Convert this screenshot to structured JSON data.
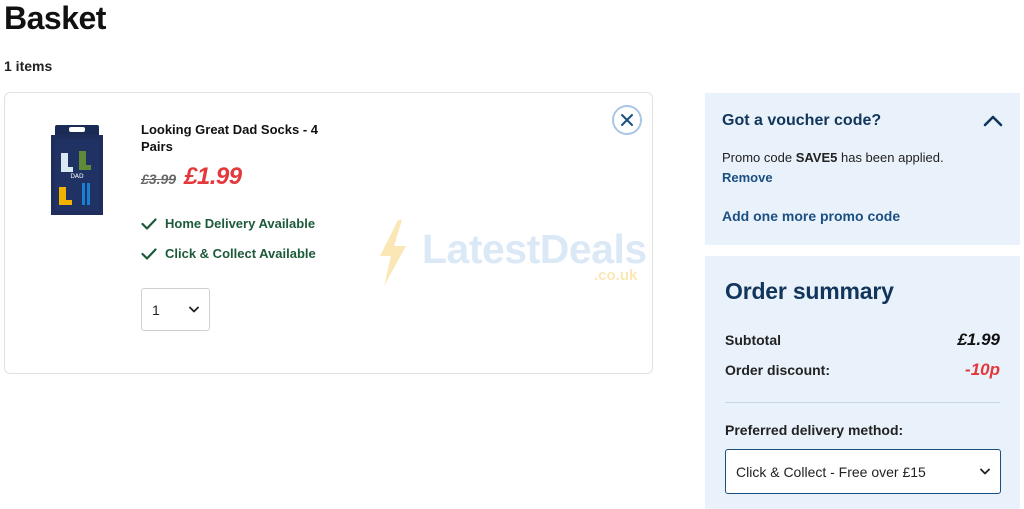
{
  "page": {
    "title": "Basket",
    "item_count": "1 items"
  },
  "basket_item": {
    "name": "Looking Great Dad Socks - 4 Pairs",
    "old_price": "£3.99",
    "price": "£1.99",
    "availability": [
      "Home Delivery Available",
      "Click & Collect Available"
    ],
    "quantity": "1",
    "package_text": "DAD"
  },
  "voucher": {
    "title": "Got a voucher code?",
    "promo_prefix": "Promo code ",
    "promo_code": "SAVE5",
    "promo_suffix": " has been applied.",
    "remove_label": "Remove",
    "add_promo_label": "Add one more promo code"
  },
  "order_summary": {
    "title": "Order summary",
    "subtotal_label": "Subtotal",
    "subtotal_value": "£1.99",
    "discount_label": "Order discount:",
    "discount_value": "-10p",
    "delivery_label": "Preferred delivery method:",
    "delivery_selected": "Click & Collect - Free over £15"
  },
  "watermark": {
    "text": "LatestDeals",
    "sub": ".co.uk"
  },
  "colors": {
    "price_red": "#e4393c",
    "navy": "#12355b",
    "link_blue": "#1b4f82",
    "panel_bg": "#e9f2fb",
    "availability_green": "#1c5a3a"
  }
}
